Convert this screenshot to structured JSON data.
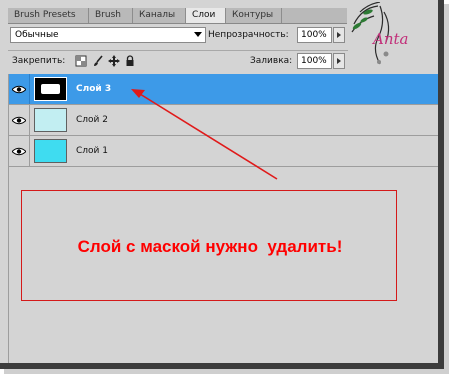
{
  "tabs": [
    {
      "label": "Brush Presets",
      "active": false
    },
    {
      "label": "Brush",
      "active": false
    },
    {
      "label": "Каналы",
      "active": false
    },
    {
      "label": "Слои",
      "active": true
    },
    {
      "label": "Контуры",
      "active": false
    }
  ],
  "blend_mode": {
    "value": "Обычные"
  },
  "opacity": {
    "label": "Непрозрачность:",
    "value": "100%"
  },
  "lock": {
    "label": "Закрепить:",
    "icons": [
      "lock-transparency-icon",
      "brush-icon",
      "move-icon",
      "lock-icon"
    ]
  },
  "fill": {
    "label": "Заливка:",
    "value": "100%"
  },
  "layers": [
    {
      "name": "Слой 3",
      "selected": true,
      "thumb_color": "#000000"
    },
    {
      "name": "Слой 2",
      "selected": false,
      "thumb_color": "#c2eef2"
    },
    {
      "name": "Слой 1",
      "selected": false,
      "thumb_color": "#3fdcf0"
    }
  ],
  "annotation": {
    "text": "Слой с маской нужно  удалить!",
    "color": "#ff0000"
  },
  "logo": {
    "text": "Anta",
    "color": "#c2307a"
  },
  "colors": {
    "selection": "#3d9ae8",
    "panel": "#d4d4d4",
    "frame": "#3c3c3c"
  }
}
